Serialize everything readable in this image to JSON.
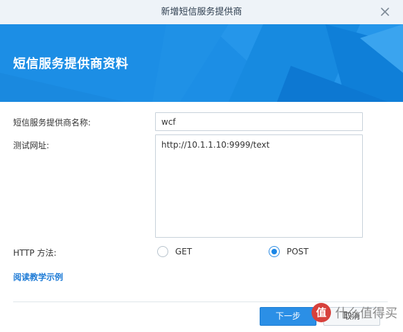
{
  "dialog": {
    "title": "新增短信服务提供商"
  },
  "banner": {
    "heading": "短信服务提供商资料"
  },
  "form": {
    "provider_name_label": "短信服务提供商名称:",
    "provider_name_value": "wcf",
    "test_url_label": "测试网址:",
    "test_url_value": "http://10.1.1.10:9999/text",
    "http_method_label": "HTTP 方法:",
    "methods": [
      {
        "label": "GET",
        "checked": false
      },
      {
        "label": "POST",
        "checked": true
      }
    ],
    "tutorial_link": "阅读教学示例"
  },
  "buttons": {
    "next_label": "下一步",
    "cancel_label": "取消"
  },
  "watermark": {
    "text": "什么值得买"
  },
  "colors": {
    "banner_blue": "#1c8ee5",
    "primary_button": "#2b8fe6",
    "radio_checked": "#1b86e6",
    "link": "#1e7bd6"
  }
}
